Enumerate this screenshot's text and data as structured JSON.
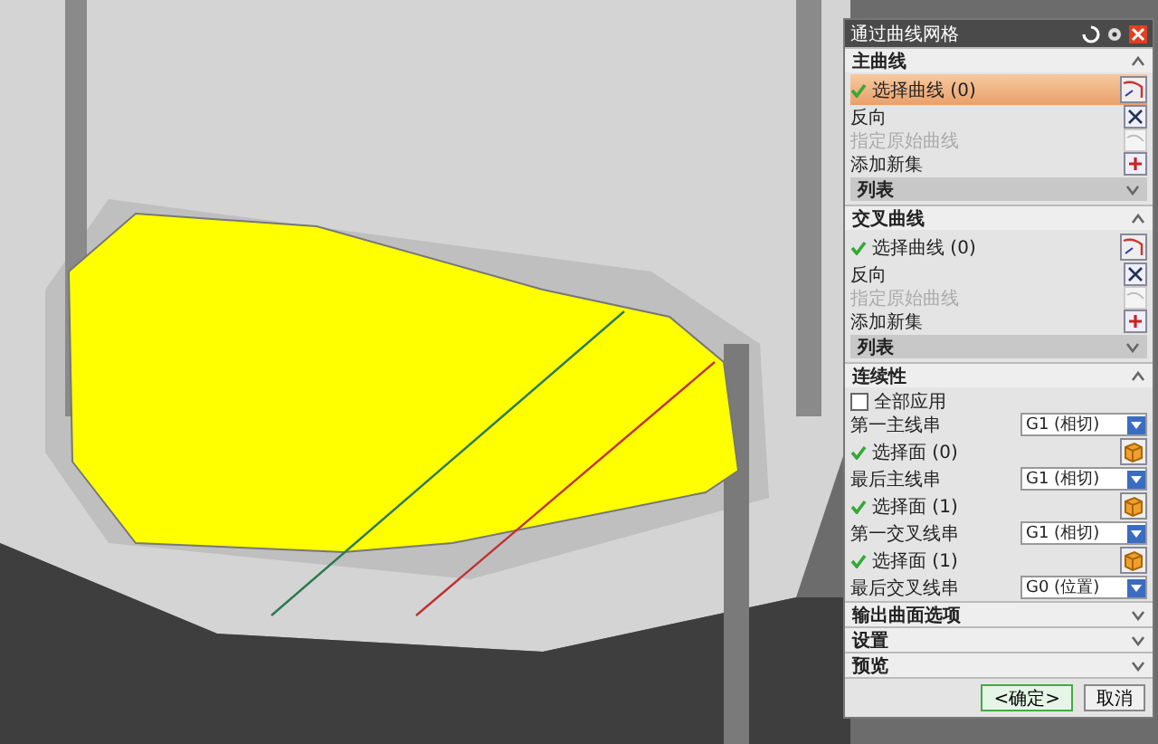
{
  "dialog": {
    "title": "通过曲线网格",
    "sections": [
      {
        "title": "主曲线",
        "expanded": true,
        "rows": [
          {
            "kind": "select",
            "label": "选择曲线 (0)",
            "checked": true,
            "selected": true
          },
          {
            "kind": "reverse",
            "label": "反向",
            "disabled": false
          },
          {
            "kind": "specify",
            "label": "指定原始曲线",
            "disabled": true
          },
          {
            "kind": "add",
            "label": "添加新集",
            "disabled": false
          },
          {
            "kind": "list",
            "label": "列表",
            "expanded": false
          }
        ]
      },
      {
        "title": "交叉曲线",
        "expanded": true,
        "rows": [
          {
            "kind": "select",
            "label": "选择曲线 (0)",
            "checked": true,
            "selected": false
          },
          {
            "kind": "reverse",
            "label": "反向",
            "disabled": false
          },
          {
            "kind": "specify",
            "label": "指定原始曲线",
            "disabled": true
          },
          {
            "kind": "add",
            "label": "添加新集",
            "disabled": false
          },
          {
            "kind": "list",
            "label": "列表",
            "expanded": false
          }
        ]
      },
      {
        "title": "连续性",
        "expanded": true,
        "rows": [
          {
            "kind": "checkbox",
            "label": "全部应用",
            "checked": false
          },
          {
            "kind": "dropdown",
            "label": "第一主线串",
            "value": "G1 (相切)"
          },
          {
            "kind": "face",
            "label": "选择面 (0)",
            "checked": true
          },
          {
            "kind": "dropdown",
            "label": "最后主线串",
            "value": "G1 (相切)"
          },
          {
            "kind": "face",
            "label": "选择面 (1)",
            "checked": true
          },
          {
            "kind": "dropdown",
            "label": "第一交叉线串",
            "value": "G1 (相切)"
          },
          {
            "kind": "face",
            "label": "选择面 (1)",
            "checked": true
          },
          {
            "kind": "dropdown",
            "label": "最后交叉线串",
            "value": "G0 (位置)"
          }
        ]
      },
      {
        "title": "输出曲面选项",
        "expanded": false
      },
      {
        "title": "设置",
        "expanded": false
      },
      {
        "title": "预览",
        "expanded": false
      }
    ],
    "buttons": [
      "<确定>",
      "取消"
    ]
  }
}
